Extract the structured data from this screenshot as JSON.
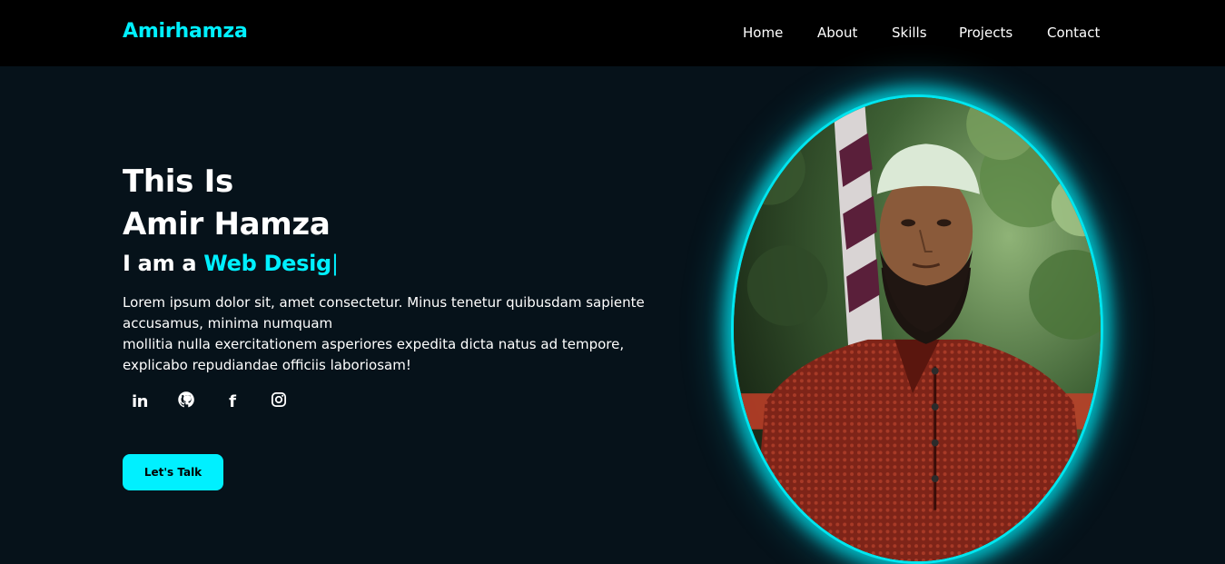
{
  "brand": {
    "name": "Amirhamza",
    "accent": "#00f0ff"
  },
  "nav": {
    "items": [
      {
        "label": "Home"
      },
      {
        "label": "About"
      },
      {
        "label": "Skills"
      },
      {
        "label": "Projects"
      },
      {
        "label": "Contact"
      }
    ]
  },
  "hero": {
    "line1": "This Is",
    "line2": "Amir Hamza",
    "typed_prefix": "I am a ",
    "typed_text": "Web Desig",
    "cursor": "|",
    "description": [
      "Lorem ipsum dolor sit, amet consectetur. Minus tenetur quibusdam sapiente accusamus, minima numquam",
      "mollitia nulla exercitationem asperiores expedita dicta natus ad tempore, explicabo repudiandae officiis laboriosam!"
    ],
    "cta_label": "Let's Talk"
  },
  "socials": [
    {
      "icon": "linkedin-icon",
      "glyph": "in"
    },
    {
      "icon": "github-icon"
    },
    {
      "icon": "facebook-icon",
      "glyph": "f"
    },
    {
      "icon": "instagram-icon"
    }
  ],
  "colors": {
    "background": "#06121a",
    "navbar": "#000000",
    "accent": "#00f0ff",
    "text": "#ffffff"
  }
}
